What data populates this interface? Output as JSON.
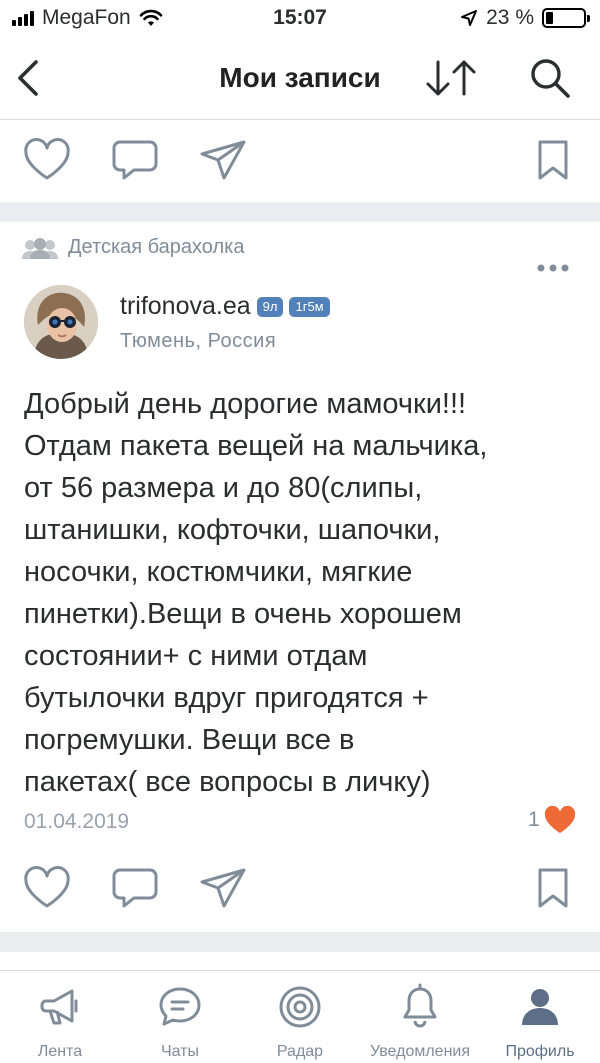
{
  "status_bar": {
    "carrier": "MegaFon",
    "time": "15:07",
    "battery": "23 %",
    "battery_level": 0.23
  },
  "header": {
    "title": "Мои записи"
  },
  "post": {
    "source": "Детская барахолка",
    "author_name": "trifonova.ea",
    "badges": [
      "9л",
      "1г5м"
    ],
    "location": "Тюмень, Россия",
    "text": "Добрый день дорогие мамочки!!!\nОтдам пакета вещей на мальчика,\nот 56 размера и до 80(слипы,\nштанишки, кофточки, шапочки,\nносочки, костюмчики, мягкие\nпинетки).Вещи в очень хорошем\nсостоянии+ с ними отдам\nбутылочки вдруг пригодятся +\nпогремушки. Вещи все в\nпакетах( все вопросы в личку)",
    "date": "01.04.2019",
    "likes": "1"
  },
  "tabs": [
    {
      "label": "Лента",
      "icon": "megaphone-icon"
    },
    {
      "label": "Чаты",
      "icon": "chat-bubble-icon"
    },
    {
      "label": "Радар",
      "icon": "radar-icon"
    },
    {
      "label": "Уведомления",
      "icon": "bell-icon"
    },
    {
      "label": "Профиль",
      "icon": "person-icon"
    }
  ],
  "colors": {
    "accent": "#5181b8",
    "like": "#ee6b37",
    "icon_gray": "#818c99",
    "separator": "#ebedf0"
  }
}
